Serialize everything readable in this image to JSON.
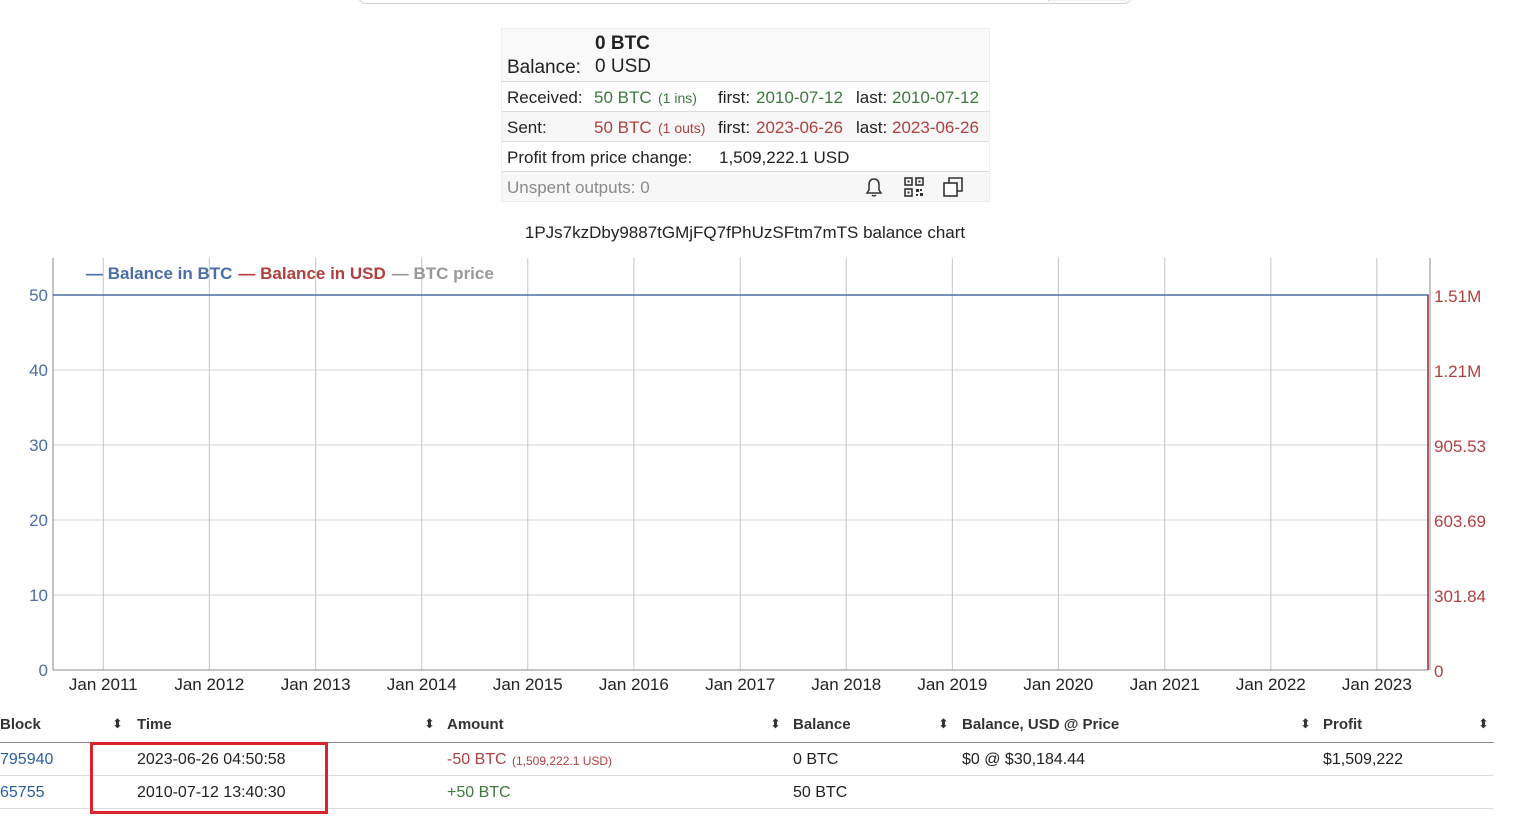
{
  "summary": {
    "balance_label": "Balance:",
    "balance_btc": "0 BTC",
    "balance_usd": "0 USD",
    "received_label": "Received:",
    "received_amount": "50 BTC",
    "received_count": "(1 ins)",
    "received_first_label": "first:",
    "received_first": "2010-07-12",
    "received_last_label": "last:",
    "received_last": "2010-07-12",
    "sent_label": "Sent:",
    "sent_amount": "50 BTC",
    "sent_count": "(1 outs)",
    "sent_first_label": "first:",
    "sent_first": "2023-06-26",
    "sent_last_label": "last:",
    "sent_last": "2023-06-26",
    "profit_label": "Profit from price change:",
    "profit_value": "1,509,222.1 USD",
    "unspent": "Unspent outputs: 0",
    "icons": [
      "bell-icon",
      "qr-code-icon",
      "copy-icon"
    ]
  },
  "chart_title": "1PJs7kzDby9887tGMjFQ7fPhUzSFtm7mTS balance chart",
  "chart_data": {
    "type": "line",
    "title": "1PJs7kzDby9887tGMjFQ7fPhUzSFtm7mTS balance chart",
    "legend_position": "top-left",
    "x_ticks": [
      "Jan 2011",
      "Jan 2012",
      "Jan 2013",
      "Jan 2014",
      "Jan 2015",
      "Jan 2016",
      "Jan 2017",
      "Jan 2018",
      "Jan 2019",
      "Jan 2020",
      "Jan 2021",
      "Jan 2022",
      "Jan 2023"
    ],
    "xlim": [
      "2010-07-12",
      "2023-06-26"
    ],
    "y_left": {
      "ticks": [
        "0",
        "10",
        "20",
        "30",
        "40",
        "50"
      ],
      "ylim": [
        0,
        50
      ],
      "color": "#4a6fa5"
    },
    "y_right": {
      "ticks": [
        "0",
        "301.84",
        "603.69",
        "905.53",
        "1.21M",
        "1.51M"
      ],
      "ylim": [
        0,
        1509222.1
      ],
      "color": "#b04040"
    },
    "grid": true,
    "series": [
      {
        "name": "Balance in BTC",
        "color": "#4a6fa5",
        "points": [
          [
            "2010-07-12",
            50
          ],
          [
            "2023-06-26",
            50
          ],
          [
            "2023-06-26",
            0
          ]
        ]
      },
      {
        "name": "Balance in USD",
        "color": "#b04040",
        "points": [
          [
            "2023-06-26",
            1509222.1
          ],
          [
            "2023-06-26",
            0
          ]
        ]
      },
      {
        "name": "BTC price",
        "color": "#999999",
        "points": []
      }
    ]
  },
  "table": {
    "columns": [
      "Block",
      "Time",
      "Amount",
      "Balance",
      "Balance, USD @ Price",
      "Profit"
    ],
    "sort_icon": "⬍",
    "rows": [
      {
        "block": "795940",
        "time": "2023-06-26 04:50:58",
        "amount": "-50 BTC",
        "amount_usd": "(1,509,222.1 USD)",
        "balance": "0 BTC",
        "balance_usd": "$0 @ $30,184.44",
        "profit": "$1,509,222"
      },
      {
        "block": "65755",
        "time": "2010-07-12 13:40:30",
        "amount": "+50 BTC",
        "amount_usd": "",
        "balance": "50 BTC",
        "balance_usd": "",
        "profit": ""
      }
    ]
  },
  "colors": {
    "btc": "#4a6fa5",
    "usd": "#b04040",
    "price": "#999999",
    "positive": "#3c7a3c",
    "highlight": "#d9232d"
  }
}
